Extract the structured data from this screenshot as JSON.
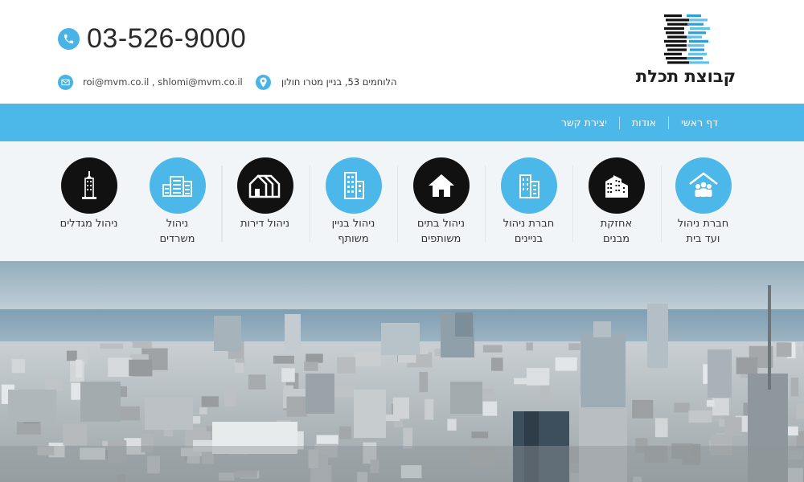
{
  "header": {
    "phone": "03-526-9000",
    "emails": "roi@mvm.co.il , shlomi@mvm.co.il",
    "address": "הלוחמים 53, בניין מטרו חולון",
    "logo_text": "קבוצת תכלת"
  },
  "nav": {
    "items": [
      "דף ראשי",
      "אודות",
      "יצירת קשר"
    ]
  },
  "services": [
    {
      "line1": "חברת ניהול",
      "line2": "ועד בית",
      "color": "blue",
      "icon": "people-house-icon"
    },
    {
      "line1": "אחזקת",
      "line2": "מבנים",
      "color": "black",
      "icon": "buildings-icon"
    },
    {
      "line1": "חברת ניהול",
      "line2": "בניינים",
      "color": "blue",
      "icon": "office-building-icon"
    },
    {
      "line1": "ניהול בתים",
      "line2": "משותפים",
      "color": "black",
      "icon": "house-icon"
    },
    {
      "line1": "ניהול בניין",
      "line2": "משותף",
      "color": "blue",
      "icon": "tower-block-icon"
    },
    {
      "line1": "ניהול דירות",
      "line2": "",
      "color": "black",
      "icon": "houses-row-icon"
    },
    {
      "line1": "ניהול",
      "line2": "משרדים",
      "color": "blue",
      "icon": "offices-icon"
    },
    {
      "line1": "ניהול מגדלים",
      "line2": "",
      "color": "black",
      "icon": "skyscraper-icon"
    }
  ],
  "colors": {
    "accent": "#4cb8ea",
    "dark": "#111111",
    "band": "#f2f5f8"
  }
}
